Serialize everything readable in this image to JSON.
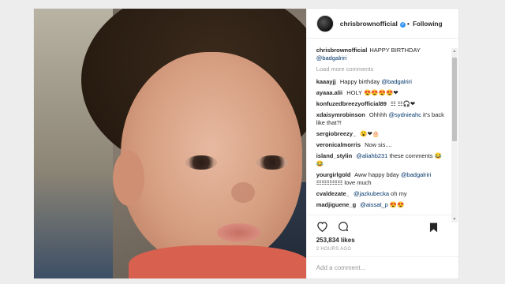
{
  "post": {
    "username": "chrisbrownofficial",
    "verified_glyph": "✓",
    "separator": "•",
    "follow_label": "Following",
    "caption": {
      "user": "chrisbrownofficial",
      "text": "HAPPY BIRTHDAY",
      "mention": "@badgalriri"
    },
    "load_more": "Load more comments",
    "comments": [
      {
        "user": "kaaayjj",
        "text": "Happy birthday",
        "mention": "@badgalriri",
        "after": ""
      },
      {
        "user": "ayaaa.alii",
        "text": "HOLY 😍😍😍😍❤",
        "mention": "",
        "after": ""
      },
      {
        "user": "konfuzedbreezyofficial89",
        "text": "☷ ☷🎧❤",
        "mention": "",
        "after": ""
      },
      {
        "user": "xdaisymrobinson",
        "text": "Ohhhh",
        "mention": "@sydnieahc",
        "after": "it's back like that?!"
      },
      {
        "user": "sergiobreezy_",
        "text": "😮❤🎂",
        "mention": "",
        "after": ""
      },
      {
        "user": "veronicalmorris",
        "text": "Now sis....",
        "mention": "",
        "after": ""
      },
      {
        "user": "island_stylin",
        "text": "",
        "mention": "@aliahb231",
        "after": "these comments 😂😂"
      },
      {
        "user": "yourgirlgold",
        "text": "Aww happy bday",
        "mention": "@badgalriri",
        "after": "☷☷☷☷☷ love much"
      },
      {
        "user": "cvaldezate_",
        "text": "",
        "mention": "@jazkubecka",
        "after": "oh my"
      },
      {
        "user": "madjiguene_g",
        "text": "",
        "mention": "@aissat_p",
        "after": "😍😍"
      }
    ],
    "likes": "253,834 likes",
    "time": "2 HOURS AGO",
    "add_comment_placeholder": "Add a comment..."
  }
}
